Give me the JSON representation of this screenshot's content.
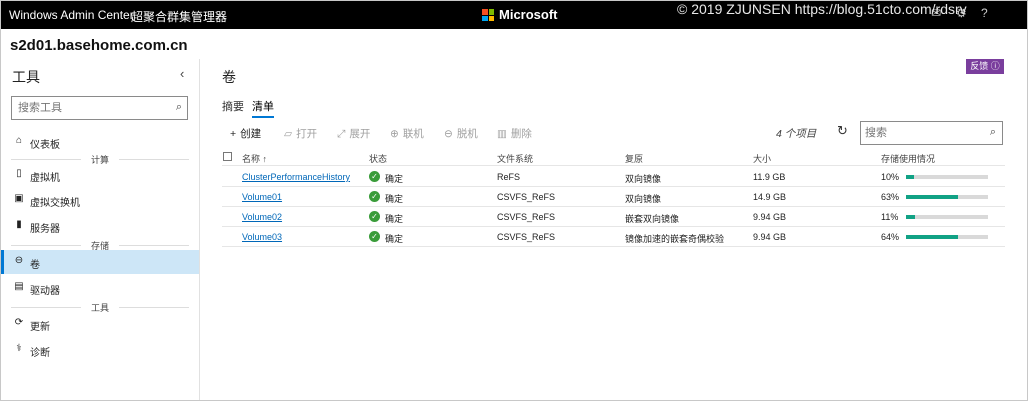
{
  "topbar": {
    "app_title": "Windows Admin Center",
    "manager": "超聚合群集管理器",
    "brand": "Microsoft",
    "watermark": "© 2019 ZJUNSEN https://blog.51cto.com/rdsrv"
  },
  "host": "s2d01.basehome.com.cn",
  "sidebar": {
    "title": "工具",
    "search_placeholder": "搜索工具",
    "items": [
      {
        "label": "仪表板",
        "icon": "home-icon"
      },
      {
        "section": "计算"
      },
      {
        "label": "虚拟机",
        "icon": "vm-icon"
      },
      {
        "label": "虚拟交换机",
        "icon": "switch-icon"
      },
      {
        "label": "服务器",
        "icon": "server-icon"
      },
      {
        "section": "存储"
      },
      {
        "label": "卷",
        "icon": "volume-icon",
        "active": true
      },
      {
        "label": "驱动器",
        "icon": "drive-icon"
      },
      {
        "section": "工具"
      },
      {
        "label": "更新",
        "icon": "update-icon"
      },
      {
        "label": "诊断",
        "icon": "stethoscope-icon"
      }
    ]
  },
  "main": {
    "title": "卷",
    "feedback": "反馈 ⓘ",
    "tabs": [
      "摘要",
      "清单"
    ],
    "active_tab": 1,
    "toolbar": [
      {
        "label": "创建",
        "icon": "+",
        "enabled": true
      },
      {
        "label": "打开",
        "icon": "📂",
        "enabled": false
      },
      {
        "label": "展开",
        "icon": "⤢",
        "enabled": false
      },
      {
        "label": "联机",
        "icon": "⊕",
        "enabled": false
      },
      {
        "label": "脱机",
        "icon": "⊖",
        "enabled": false
      },
      {
        "label": "删除",
        "icon": "🗑",
        "enabled": false
      }
    ],
    "count": "4 个项目",
    "search_placeholder": "搜索",
    "columns": [
      "名称 ↑",
      "状态",
      "文件系统",
      "复原",
      "大小",
      "存储使用情况"
    ],
    "rows": [
      {
        "name": "ClusterPerformanceHistory",
        "status": "确定",
        "fs": "ReFS",
        "resiliency": "双向镜像",
        "size": "11.9 GB",
        "usage": "10%",
        "usage_value": 10
      },
      {
        "name": "Volume01",
        "status": "确定",
        "fs": "CSVFS_ReFS",
        "resiliency": "双向镜像",
        "size": "14.9 GB",
        "usage": "63%",
        "usage_value": 63
      },
      {
        "name": "Volume02",
        "status": "确定",
        "fs": "CSVFS_ReFS",
        "resiliency": "嵌套双向镜像",
        "size": "9.94 GB",
        "usage": "11%",
        "usage_value": 11
      },
      {
        "name": "Volume03",
        "status": "确定",
        "fs": "CSVFS_ReFS",
        "resiliency": "镜像加速的嵌套奇偶校验",
        "size": "9.94 GB",
        "usage": "64%",
        "usage_value": 64
      }
    ]
  },
  "colors": {
    "accent": "#0078d4",
    "bar_fill": "#11a285",
    "feedback": "#7a3e9d",
    "ok": "#3a9c3a"
  }
}
